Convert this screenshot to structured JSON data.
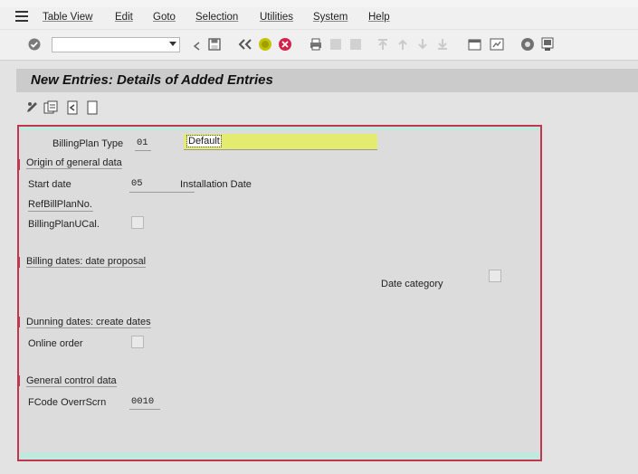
{
  "menu": {
    "items": [
      "Table View",
      "Edit",
      "Goto",
      "Selection",
      "Utilities",
      "System",
      "Help"
    ]
  },
  "toolbar": {
    "command_value": ""
  },
  "screen": {
    "title": "New Entries: Details of Added Entries"
  },
  "form": {
    "billing_plan_type_label": "BillingPlan Type",
    "billing_plan_type_code": "01",
    "billing_plan_type_desc": "Default",
    "origin_section": "Origin of general data",
    "start_date_label": "Start date",
    "start_date_value": "05",
    "start_date_desc": "Installation Date",
    "ref_plan_label": "RefBillPlanNo.",
    "billing_plan_ucal_label": "BillingPlanUCal.",
    "billing_section": "Billing dates: date proposal",
    "date_category_label": "Date category",
    "dunning_section": "Dunning dates: create dates",
    "online_order_label": "Online order",
    "general_section": "General control data",
    "fcode_label": "FCode OverrScrn",
    "fcode_value": "0010"
  },
  "colors": {
    "accent_border": "#c2364e",
    "highlight_field": "#e4ec70",
    "teal_band": "#bfe8df"
  }
}
